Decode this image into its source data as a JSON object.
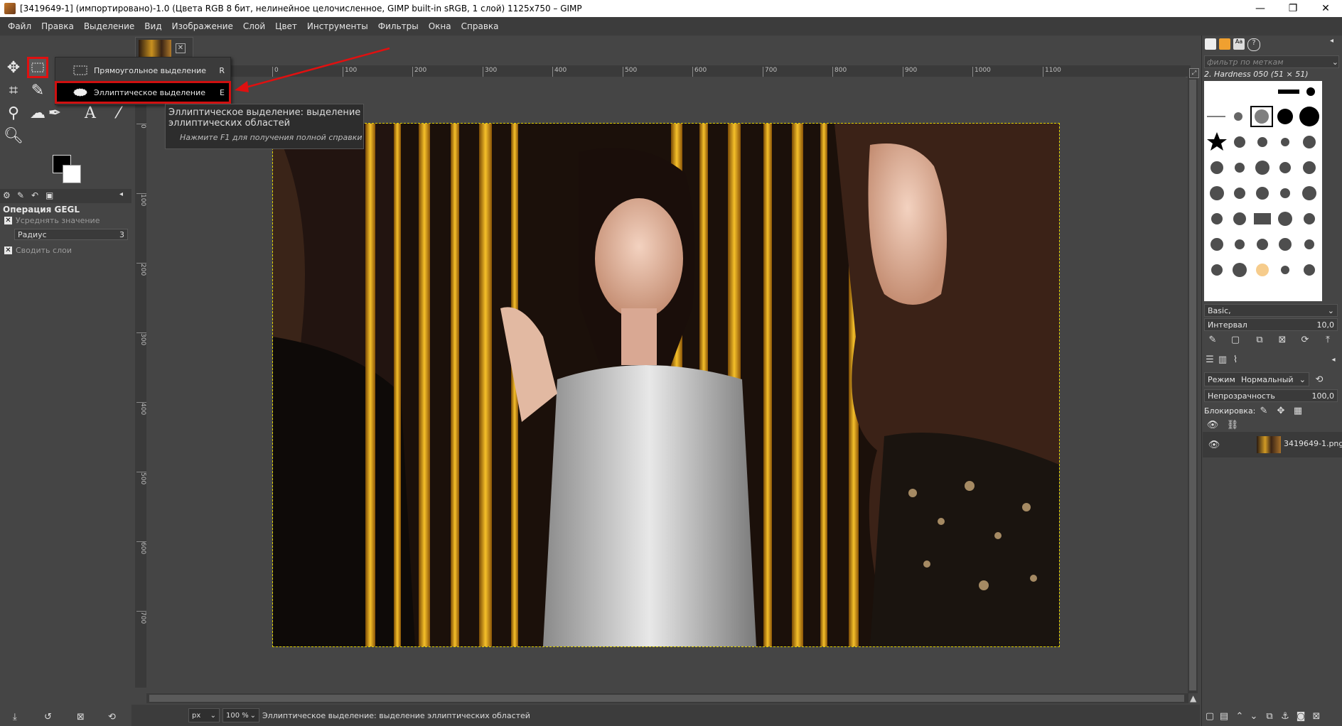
{
  "window": {
    "title": "[3419649-1] (импортировано)-1.0 (Цвета RGB 8 бит, нелинейное целочисленное, GIMP built-in sRGB, 1 слой) 1125x750 – GIMP",
    "minimize": "—",
    "maximize": "❐",
    "close": "✕"
  },
  "menubar": [
    "Файл",
    "Правка",
    "Выделение",
    "Вид",
    "Изображение",
    "Слой",
    "Цвет",
    "Инструменты",
    "Фильтры",
    "Окна",
    "Справка"
  ],
  "tool_menu": {
    "items": [
      {
        "label": "Прямоугольное выделение",
        "shortcut": "R"
      },
      {
        "label": "Эллиптическое выделение",
        "shortcut": "E"
      }
    ]
  },
  "tooltip": {
    "line1": "Эллиптическое выделение: выделение",
    "line2": "эллиптических областей",
    "hint": "Нажмите F1 для получения полной справки"
  },
  "tool_options": {
    "title": "Операция GEGL",
    "opt1": "Усреднять значение",
    "radius_label": "Радиус",
    "radius_value": "3",
    "opt2": "Сводить слои"
  },
  "ruler": {
    "h": [
      "0",
      "100",
      "200",
      "300",
      "400",
      "500",
      "600",
      "700",
      "800",
      "900",
      "1000",
      "1100"
    ],
    "v": [
      "0",
      "100",
      "200",
      "300",
      "400",
      "500",
      "600",
      "700"
    ]
  },
  "status": {
    "unit": "px",
    "zoom": "100 %",
    "message": "Эллиптическое выделение: выделение эллиптических областей"
  },
  "right_panel": {
    "brush_filter": "фильтр по меткам",
    "brush_name": "2. Hardness 050 (51 × 51)",
    "brush_set": "Basic,",
    "spacing_label": "Интервал",
    "spacing_value": "10,0",
    "mode_label": "Режим",
    "mode_value": "Нормальный",
    "opacity_label": "Непрозрачность",
    "opacity_value": "100,0",
    "lock_label": "Блокировка:",
    "layer_name": "3419649-1.png"
  },
  "colors": {
    "highlight": "#d01010",
    "selection": "#e0d000"
  }
}
